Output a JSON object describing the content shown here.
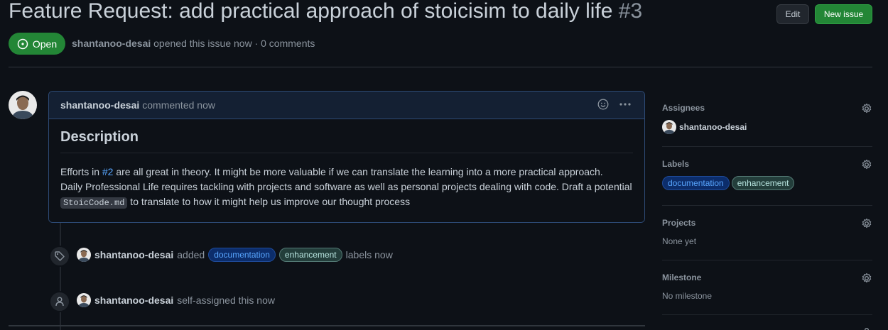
{
  "issue": {
    "title": "Feature Request: add practical approach of stoicisim to daily life",
    "number": "#3",
    "state": "Open",
    "author": "shantanoo-desai",
    "meta_text": "opened this issue now · 0 comments"
  },
  "header": {
    "edit_label": "Edit",
    "new_issue_label": "New issue"
  },
  "comment": {
    "author": "shantanoo-desai",
    "when": "commented now",
    "heading": "Description",
    "line1_a": "Efforts in ",
    "line1_link": "#2",
    "line1_b": " are all great in theory. It might be more valuable if we can translate the learning into a more practical approach.",
    "line2": "Daily Professional Life requires tackling with projects and software as well as personal projects dealing with code. Draft a potential",
    "line3_code": "StoicCode.md",
    "line3_rest": " to translate to how it might help us improve our thought process"
  },
  "timeline": [
    {
      "actor": "shantanoo-desai",
      "action": "added",
      "labels": [
        "documentation",
        "enhancement"
      ],
      "suffix": "labels now",
      "icon": "tag-icon"
    },
    {
      "actor": "shantanoo-desai",
      "action": "self-assigned this now",
      "icon": "person-icon"
    }
  ],
  "sidebar": {
    "assignees": {
      "title": "Assignees",
      "value": "shantanoo-desai"
    },
    "labels": {
      "title": "Labels",
      "items": [
        "documentation",
        "enhancement"
      ]
    },
    "projects": {
      "title": "Projects",
      "value": "None yet"
    },
    "milestone": {
      "title": "Milestone",
      "value": "No milestone"
    }
  },
  "colors": {
    "open_green": "#238636",
    "link_blue": "#58a6ff",
    "background": "#0d1117"
  }
}
